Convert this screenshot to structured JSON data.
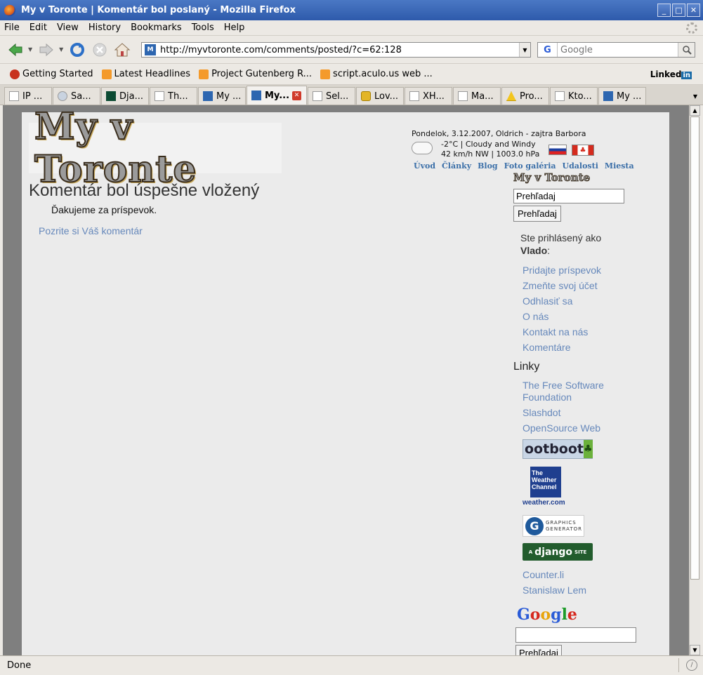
{
  "window": {
    "title": "My v Toronte | Komentár bol poslaný - Mozilla Firefox",
    "controls": [
      "_",
      "□",
      "✕"
    ]
  },
  "menu": [
    "File",
    "Edit",
    "View",
    "History",
    "Bookmarks",
    "Tools",
    "Help"
  ],
  "nav": {
    "url": "http://myvtoronte.com/comments/posted/?c=62:128",
    "favicon": "M",
    "search_engine": "G",
    "search_placeholder": "Google"
  },
  "bookmarks": {
    "items": [
      "Getting Started",
      "Latest Headlines",
      "Project Gutenberg R...",
      "script.aculo.us web ..."
    ],
    "linkedin": "Linked",
    "linkedin_in": "in"
  },
  "tabs": [
    {
      "label": "IP ...",
      "icon": "page"
    },
    {
      "label": "Sa...",
      "icon": "globe"
    },
    {
      "label": "Dja...",
      "icon": "django"
    },
    {
      "label": "Th...",
      "icon": "page"
    },
    {
      "label": "My ...",
      "icon": "m"
    },
    {
      "label": "My...",
      "icon": "m",
      "active": true
    },
    {
      "label": "Sel...",
      "icon": "page"
    },
    {
      "label": "Lov...",
      "icon": "imdb"
    },
    {
      "label": "XH...",
      "icon": "page"
    },
    {
      "label": "Ma...",
      "icon": "page"
    },
    {
      "label": "Pro...",
      "icon": "warning"
    },
    {
      "label": "Kto...",
      "icon": "page"
    },
    {
      "label": "My ...",
      "icon": "m"
    }
  ],
  "page": {
    "logo_text": "My v Toronte",
    "dateline": "Pondelok, 3.12.2007, Oldrich - zajtra Barbora",
    "weather_line1": "-2°C  | Cloudy and Windy",
    "weather_line2": "42 km/h NW  | 1003.0 hPa",
    "topnav": [
      "Úvod",
      "Články",
      "Blog",
      "Foto galéria",
      "Udalosti",
      "Miesta"
    ],
    "title": "Komentár bol úspešne vložený",
    "thanks": "Ďakujeme za príspevok.",
    "view_comment": "Pozrite si Váš komentár"
  },
  "sidebar": {
    "mini_logo": "My v Toronte",
    "search_value": "Prehľadaj",
    "search_button": "Prehľadaj",
    "logged_in_prefix": "Ste prihlásený ako",
    "username": "Vlado",
    "user_links": [
      "Pridajte príspevok",
      "Zmeňte svoj účet",
      "Odhlasiť sa",
      "O nás",
      "Kontakt na nás",
      "Komentáre"
    ],
    "links_heading": "Linky",
    "links": [
      "The Free Software Foundation",
      "Slashdot",
      "OpenSource Web"
    ],
    "badges": {
      "ootboot": "ootboot",
      "twc": "The Weather Channel",
      "twc_site": "weather.com",
      "gg_line1": "GRAPHICS",
      "gg_line2": "GENERATOR",
      "django_pre": "A",
      "django": "django",
      "django_post": "SITE"
    },
    "more_links": [
      "Counter.li",
      "Stanislaw Lem"
    ],
    "google_search_button": "Prehľadaj"
  },
  "status": {
    "text": "Done"
  }
}
